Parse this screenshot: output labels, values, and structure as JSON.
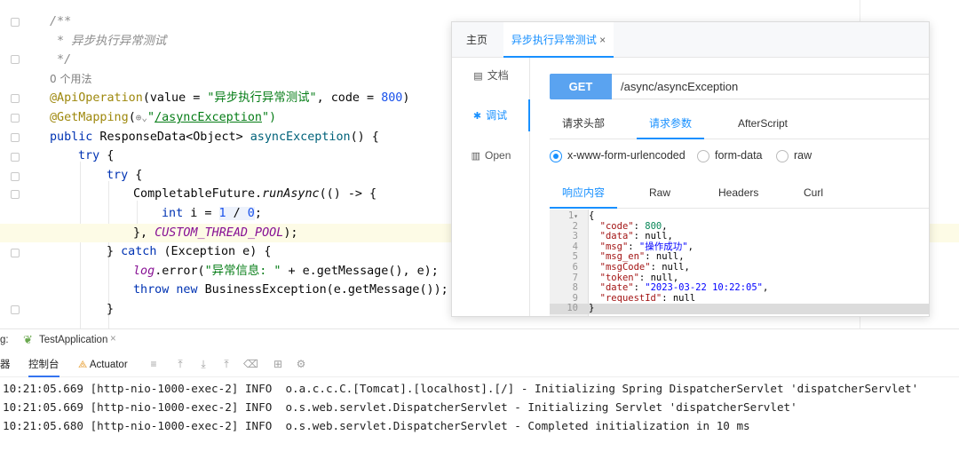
{
  "editor": {
    "comment_open": "/**",
    "comment_desc": " * 异步执行异常测试",
    "comment_close": " */",
    "usages": "0 个用法",
    "l_api_ann": "@ApiOperation",
    "l_api_p1": "(value = ",
    "l_api_str": "\"异步执行异常测试\"",
    "l_api_p2": ", code = ",
    "l_api_num": "800",
    "l_api_p3": ")",
    "l_get_ann": "@GetMapping",
    "l_get_p1": "(",
    "l_get_icon": "⊕⌄",
    "l_get_q": "\"",
    "l_get_path": "/asyncException",
    "l_get_p2": "\")",
    "l_m_kw": "public",
    "l_m_type": " ResponseData<Object> ",
    "l_m_name": "asyncException",
    "l_m_p": "() {",
    "l_try1": "try",
    "l_try1_b": " {",
    "l_try2": "try",
    "l_try2_b": " {",
    "l_cf_cls": "CompletableFuture.",
    "l_cf_m": "runAsync",
    "l_cf_p": "(() -> {",
    "l_int_kw": "int",
    "l_int_p1": " i = ",
    "l_int_n1": "1",
    "l_int_op": " / ",
    "l_int_n2": "0",
    "l_int_p2": ";",
    "l_pool_p1": "}, ",
    "l_pool_f": "CUSTOM_THREAD_POOL",
    "l_pool_p2": ");",
    "l_catch_p1": "} ",
    "l_catch_kw": "catch",
    "l_catch_p2": " (Exception e) {",
    "l_log_f": "log",
    "l_log_p1": ".error(",
    "l_log_s": "\"异常信息: \"",
    "l_log_p2": " + e.getMessage(), e);",
    "l_throw_kw1": "throw",
    "l_throw_sp": " ",
    "l_throw_kw2": "new",
    "l_throw_p": " BusinessException(e.getMessage());",
    "l_close": "}"
  },
  "panel": {
    "tab_home": "主页",
    "tab_active": "异步执行异常测试",
    "tab_close": "×",
    "side_doc": "文档",
    "side_debug": "调试",
    "side_open": "Open",
    "method": "GET",
    "url": "/async/asyncException",
    "req_tabs": [
      "请求头部",
      "请求参数",
      "AfterScript"
    ],
    "radios": [
      "x-www-form-urlencoded",
      "form-data",
      "raw"
    ],
    "resp_tabs": [
      "响应内容",
      "Raw",
      "Headers",
      "Curl"
    ],
    "json": {
      "n1": "1",
      "open": "{",
      "fold": "▾",
      "n2": "2",
      "k_code": "\"code\"",
      "v_code": "800",
      "n3": "3",
      "k_data": "\"data\"",
      "v_data": "null",
      "n4": "4",
      "k_msg": "\"msg\"",
      "v_msg": "\"操作成功\"",
      "n5": "5",
      "k_msg_en": "\"msg_en\"",
      "v_msg_en": "null",
      "n6": "6",
      "k_msgCode": "\"msgCode\"",
      "v_msgCode": "null",
      "n7": "7",
      "k_token": "\"token\"",
      "v_token": "null",
      "n8": "8",
      "k_date": "\"date\"",
      "v_date": "\"2023-03-22 10:22:05\"",
      "n9": "9",
      "k_reqId": "\"requestId\"",
      "v_reqId": "null",
      "n10": "10",
      "close": "}"
    }
  },
  "bottom": {
    "run_label": "g:",
    "app_name": "TestApplication",
    "app_close": "×",
    "tb_left": "器",
    "tb_console": "控制台",
    "tb_actuator": "Actuator",
    "logs": [
      "10:21:05.669 [http-nio-1000-exec-2] INFO  o.a.c.c.C.[Tomcat].[localhost].[/] - Initializing Spring DispatcherServlet 'dispatcherServlet'",
      "10:21:05.669 [http-nio-1000-exec-2] INFO  o.s.web.servlet.DispatcherServlet - Initializing Servlet 'dispatcherServlet'",
      "10:21:05.680 [http-nio-1000-exec-2] INFO  o.s.web.servlet.DispatcherServlet - Completed initialization in 10 ms"
    ]
  },
  "colors": {
    "accent": "#1890ff",
    "get_button": "#5aa3f0",
    "keyword": "#0033b3",
    "string": "#067d17",
    "annotation": "#9e880d"
  }
}
